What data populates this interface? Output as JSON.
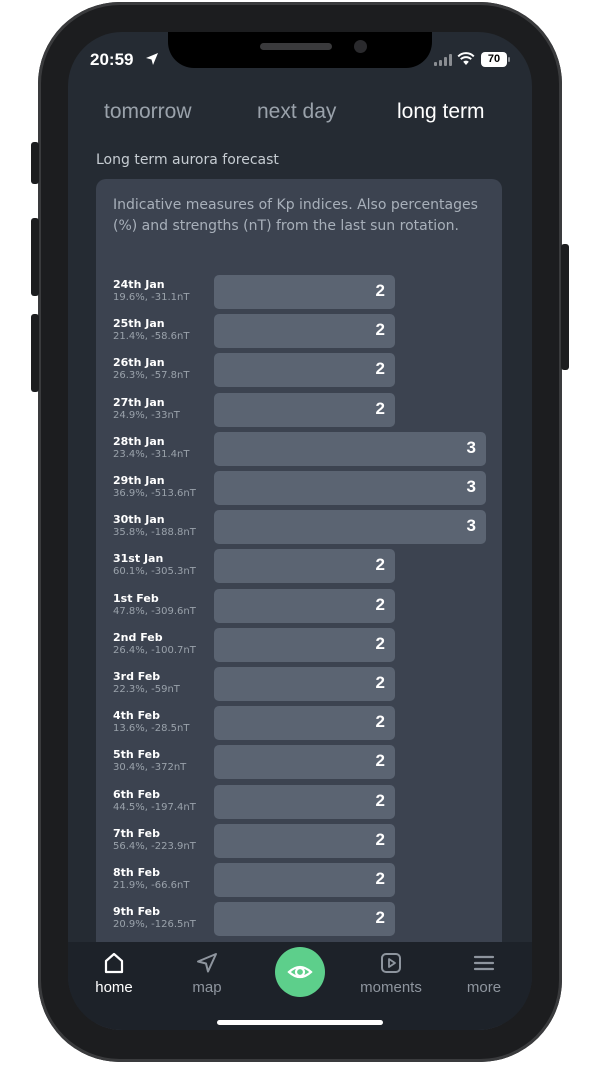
{
  "status_bar": {
    "time": "20:59",
    "battery": "70"
  },
  "tabs": [
    {
      "label": "tomorrow",
      "active": false
    },
    {
      "label": "next day",
      "active": false
    },
    {
      "label": "long term",
      "active": true
    }
  ],
  "section_title": "Long term aurora forecast",
  "card": {
    "description": "Indicative measures of Kp indices. Also percentages (%) and strengths (nT) from the last sun rotation."
  },
  "forecast": {
    "max_kp": 3,
    "rows": [
      {
        "date": "24th Jan",
        "stats": "19.6%, -31.1nT",
        "kp": 2
      },
      {
        "date": "25th Jan",
        "stats": "21.4%, -58.6nT",
        "kp": 2
      },
      {
        "date": "26th Jan",
        "stats": "26.3%, -57.8nT",
        "kp": 2
      },
      {
        "date": "27th Jan",
        "stats": "24.9%, -33nT",
        "kp": 2
      },
      {
        "date": "28th Jan",
        "stats": "23.4%, -31.4nT",
        "kp": 3
      },
      {
        "date": "29th Jan",
        "stats": "36.9%, -513.6nT",
        "kp": 3
      },
      {
        "date": "30th Jan",
        "stats": "35.8%, -188.8nT",
        "kp": 3
      },
      {
        "date": "31st Jan",
        "stats": "60.1%, -305.3nT",
        "kp": 2
      },
      {
        "date": "1st Feb",
        "stats": "47.8%, -309.6nT",
        "kp": 2
      },
      {
        "date": "2nd Feb",
        "stats": "26.4%, -100.7nT",
        "kp": 2
      },
      {
        "date": "3rd Feb",
        "stats": "22.3%, -59nT",
        "kp": 2
      },
      {
        "date": "4th Feb",
        "stats": "13.6%, -28.5nT",
        "kp": 2
      },
      {
        "date": "5th Feb",
        "stats": "30.4%, -372nT",
        "kp": 2
      },
      {
        "date": "6th Feb",
        "stats": "44.5%, -197.4nT",
        "kp": 2
      },
      {
        "date": "7th Feb",
        "stats": "56.4%, -223.9nT",
        "kp": 2
      },
      {
        "date": "8th Feb",
        "stats": "21.9%, -66.6nT",
        "kp": 2
      },
      {
        "date": "9th Feb",
        "stats": "20.9%, -126.5nT",
        "kp": 2
      }
    ]
  },
  "bottom_nav": {
    "items": [
      {
        "label": "home",
        "icon": "home-icon",
        "active": true
      },
      {
        "label": "map",
        "icon": "navigation-arrow-icon",
        "active": false
      },
      {
        "label": "",
        "icon": "eye-icon",
        "active": false
      },
      {
        "label": "moments",
        "icon": "play-square-icon",
        "active": false
      },
      {
        "label": "more",
        "icon": "menu-icon",
        "active": false
      }
    ]
  },
  "colors": {
    "background": "#252b33",
    "card": "#3c4350",
    "bar": "#5b6472",
    "accent_green": "#5dcf8b",
    "nav_background": "#1d2229"
  }
}
